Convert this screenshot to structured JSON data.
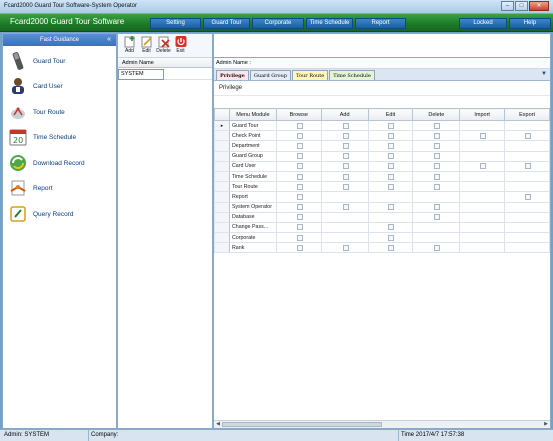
{
  "window": {
    "title": "Fcard2000 Guard Tour Software-System Operator",
    "min": "–",
    "max": "□",
    "close": "✕"
  },
  "app": {
    "title": "Fcard2000 Guard Tour Software"
  },
  "menu": [
    "Setting",
    "Guard Tour",
    "Corporate",
    "Time Schedule",
    "Report",
    "Locked",
    "Help"
  ],
  "guidance": {
    "header": "Fast Guidance",
    "items": [
      {
        "label": "Guard Tour",
        "icon": "guard-wand-icon"
      },
      {
        "label": "Card User",
        "icon": "card-user-icon"
      },
      {
        "label": "Tour Route",
        "icon": "tour-route-icon"
      },
      {
        "label": "Time Schedule",
        "icon": "calendar-icon"
      },
      {
        "label": "Download Record",
        "icon": "download-record-icon"
      },
      {
        "label": "Report",
        "icon": "report-icon"
      },
      {
        "label": "Query Record",
        "icon": "query-record-icon"
      }
    ]
  },
  "toolbar": {
    "add": "Add",
    "edit": "Edit",
    "delete": "Delete",
    "exit": "Exit"
  },
  "admin_list": {
    "header": "Admin Name",
    "selected": "SYSTEM"
  },
  "privilege_panel": {
    "header": "Admin Name :",
    "tabs": [
      "Privilege",
      "Guard Group",
      "Tour Route",
      "Time Schedule"
    ],
    "section": "Privilege",
    "columns": [
      "Menu Module",
      "Browse",
      "Add",
      "Edit",
      "Delete",
      "Import",
      "Export"
    ],
    "rows": [
      {
        "name": "Guard Tour",
        "c": [
          1,
          1,
          1,
          1,
          0,
          0
        ]
      },
      {
        "name": "Check Point",
        "c": [
          1,
          1,
          1,
          1,
          1,
          1
        ]
      },
      {
        "name": "Department",
        "c": [
          1,
          1,
          1,
          1,
          0,
          0
        ]
      },
      {
        "name": "Guard Group",
        "c": [
          1,
          1,
          1,
          1,
          0,
          0
        ]
      },
      {
        "name": "Card User",
        "c": [
          1,
          1,
          1,
          1,
          1,
          1
        ]
      },
      {
        "name": "Time Schedule",
        "c": [
          1,
          1,
          1,
          1,
          0,
          0
        ]
      },
      {
        "name": "Tour Route",
        "c": [
          1,
          1,
          1,
          1,
          0,
          0
        ]
      },
      {
        "name": "Report",
        "c": [
          1,
          0,
          0,
          0,
          0,
          1
        ]
      },
      {
        "name": "System Operator",
        "c": [
          1,
          1,
          1,
          1,
          0,
          0
        ]
      },
      {
        "name": "Database",
        "c": [
          1,
          0,
          0,
          1,
          0,
          0
        ]
      },
      {
        "name": "Change Pass...",
        "c": [
          1,
          0,
          1,
          0,
          0,
          0
        ]
      },
      {
        "name": "Corporate",
        "c": [
          1,
          0,
          1,
          0,
          0,
          0
        ]
      },
      {
        "name": "Rank",
        "c": [
          1,
          1,
          1,
          1,
          0,
          0
        ]
      }
    ]
  },
  "status": {
    "admin": "Admin: SYSTEM",
    "company": "Company:",
    "time": "Time 2017/4/7 17:57:38"
  }
}
